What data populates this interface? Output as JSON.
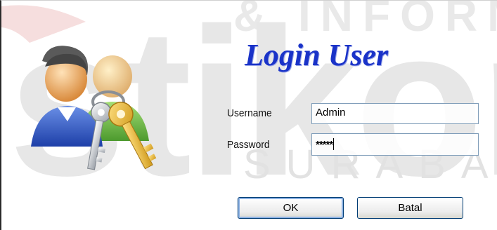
{
  "watermark": {
    "top_text": "& INFORMA",
    "big_text": "stikom",
    "bottom_text": "SURABAYA"
  },
  "dialog": {
    "title": "Login User",
    "username_label": "Username",
    "username_value": "Admin",
    "password_label": "Password",
    "password_value": "*****",
    "ok_label": "OK",
    "cancel_label": "Batal"
  },
  "colors": {
    "title": "#1a33c8",
    "input_border": "#7f9db9",
    "button_border": "#003c74",
    "watermark": "#e7e7e7"
  },
  "icons": {
    "illustration": "users-with-keys-icon"
  }
}
